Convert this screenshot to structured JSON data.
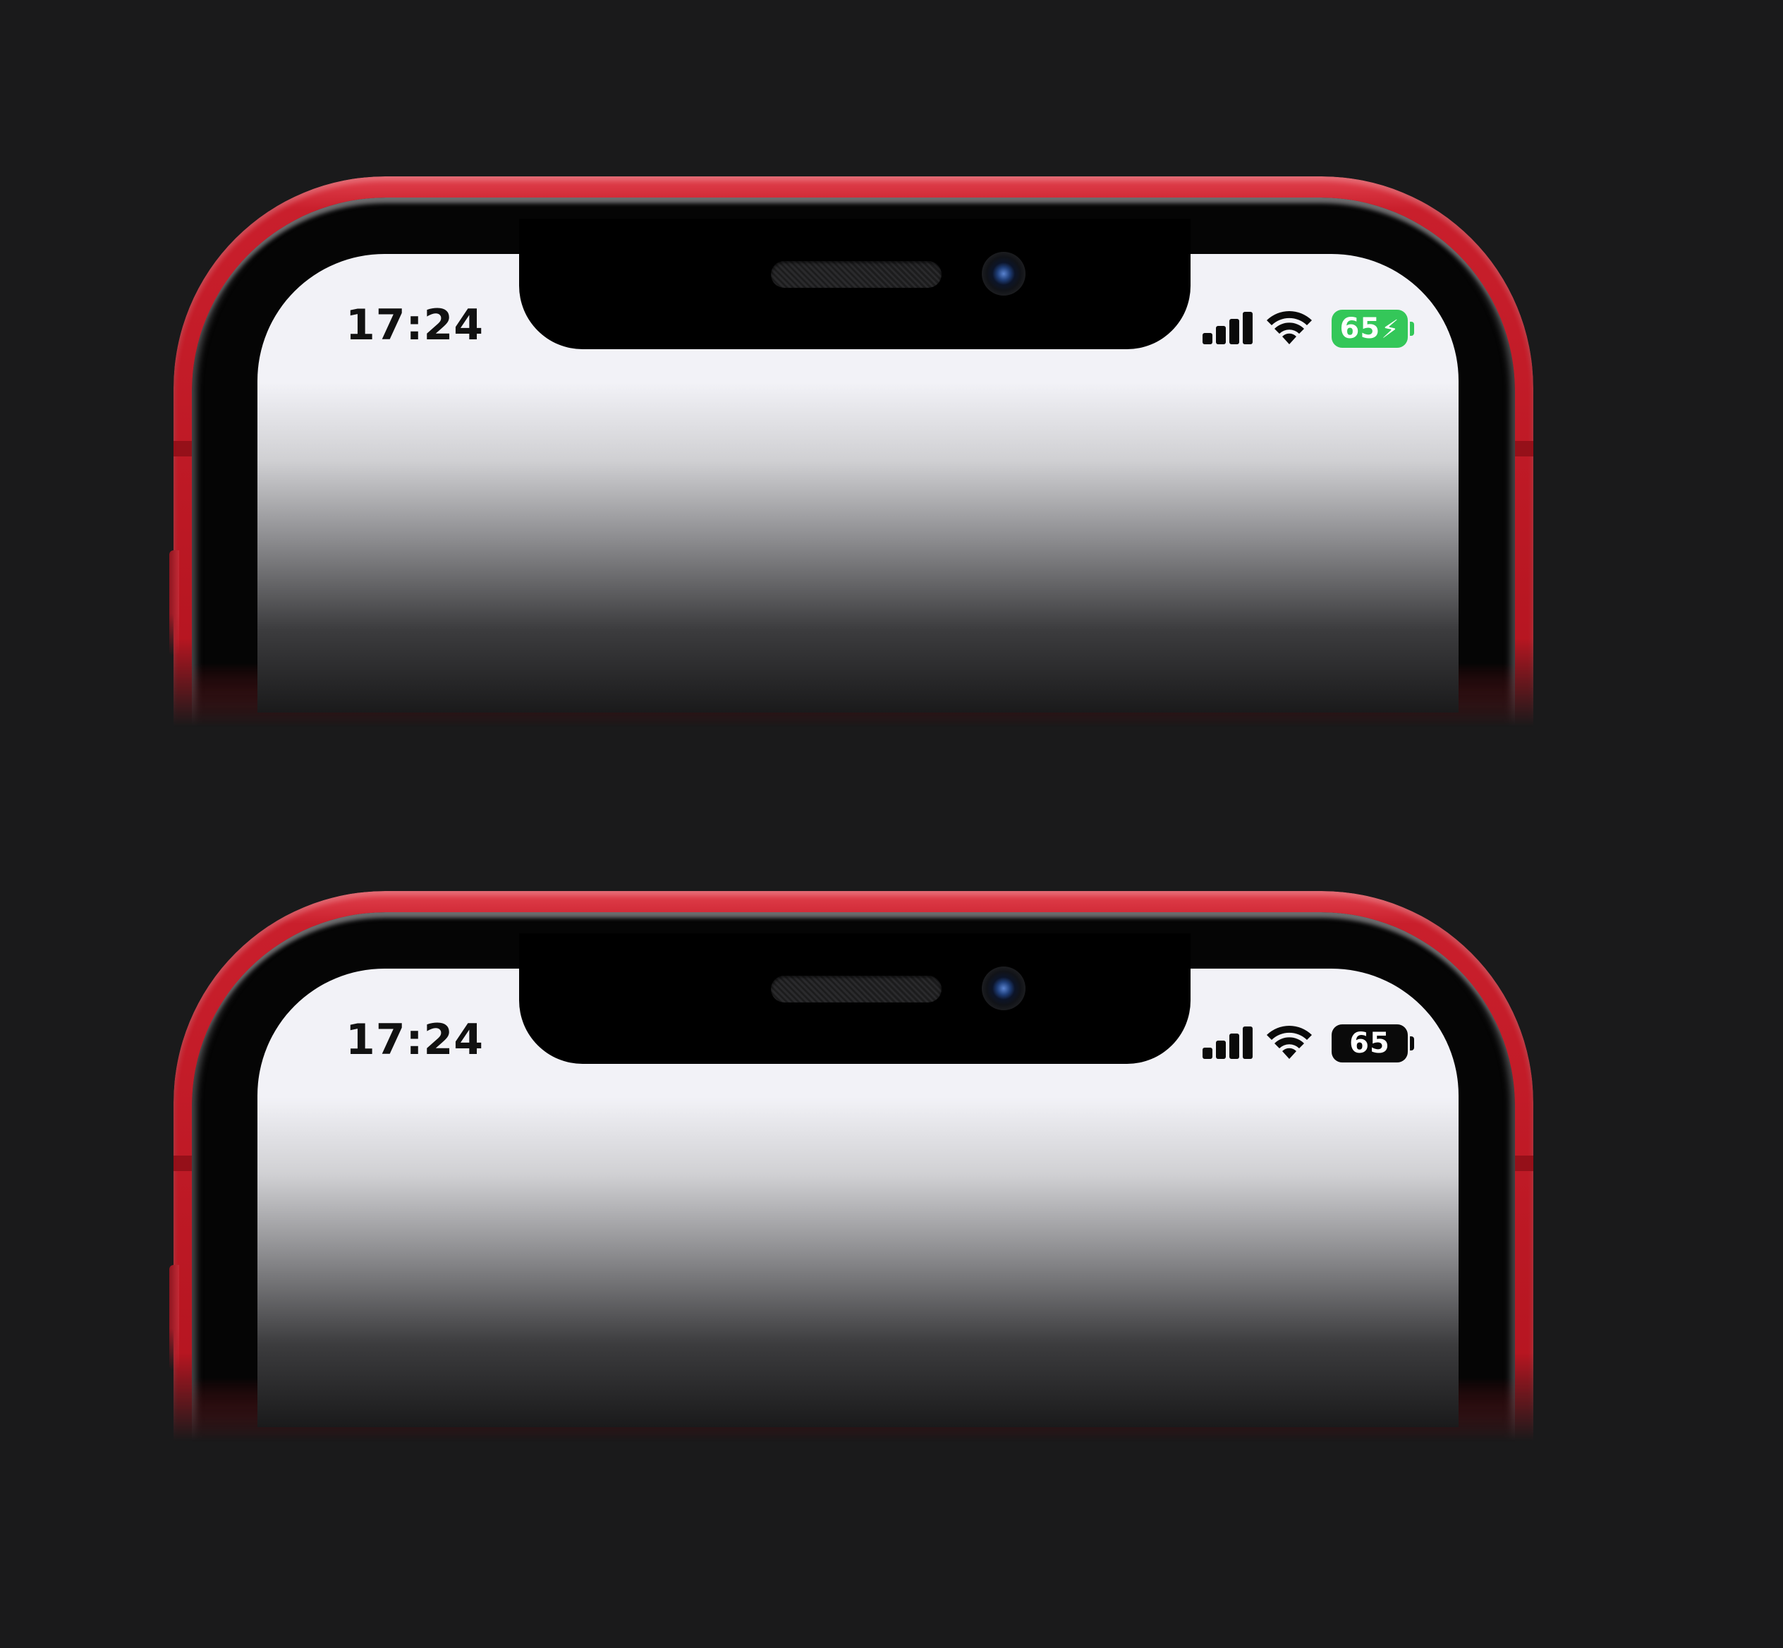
{
  "phones": [
    {
      "status_bar": {
        "time": "17:24",
        "battery_percent": "65",
        "battery_state": "charging",
        "battery_color": "#34c759"
      },
      "icons": [
        "cellular-signal-icon",
        "wifi-icon",
        "battery-icon",
        "charging-bolt-icon"
      ]
    },
    {
      "status_bar": {
        "time": "17:24",
        "battery_percent": "65",
        "battery_state": "not-charging",
        "battery_color": "#0a0a0a"
      },
      "icons": [
        "cellular-signal-icon",
        "wifi-icon",
        "battery-icon"
      ]
    }
  ],
  "colors": {
    "frame": "#c91f2c",
    "background": "#1a1a1b",
    "screen": "#f2f2f7",
    "charging_green": "#34c759"
  }
}
